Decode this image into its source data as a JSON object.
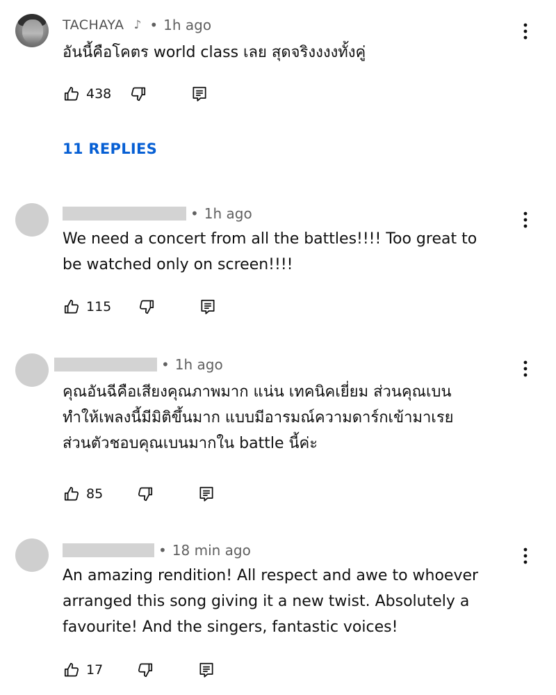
{
  "comments": [
    {
      "author": "TACHAYA",
      "time": "1h ago",
      "text": "อันนี้คือโคตร world class เลย สุดจริงงงงทั้งคู่",
      "likes": "438",
      "replies_label": "11 REPLIES"
    },
    {
      "author": "",
      "time": "1h ago",
      "text_lines": [
        "We need a concert from all the battles!!!! Too great to",
        "be watched only on screen!!!!"
      ],
      "likes": "115"
    },
    {
      "author": "",
      "time": "1h ago",
      "text_lines": [
        "คุณอันฉีคือเสียงคุณภาพมาก แน่น เทคนิคเยี่ยม ส่วนคุณเบน",
        "ทำให้เพลงนี้มีมิติขึ้นมาก แบบมีอารมณ์ความดาร์กเข้ามาเรย",
        "ส่วนตัวชอบคุณเบนมากใน battle นี้ค่ะ"
      ],
      "likes": "85"
    },
    {
      "author": "",
      "time": "18 min ago",
      "text_lines": [
        "An amazing rendition! All respect and awe to whoever",
        "arranged this song giving it a new twist. Absolutely a",
        "favourite! And the singers, fantastic voices!"
      ],
      "likes": "17"
    }
  ],
  "separator": "•",
  "icons": {
    "like": "thumbs-up-icon",
    "dislike": "thumbs-down-icon",
    "reply": "reply-icon",
    "more": "more-vert-icon",
    "music_note": "music-note-icon"
  },
  "colors": {
    "link": "#065fd4",
    "meta": "#606060",
    "redaction": "#d3d3d3",
    "avatar_placeholder": "#cfcfcf"
  }
}
